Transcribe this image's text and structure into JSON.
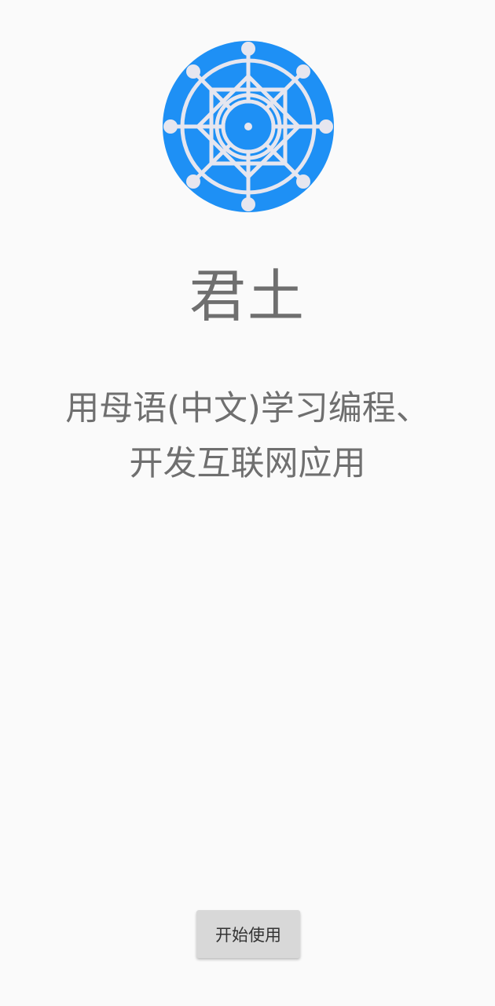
{
  "app": {
    "title": "君土",
    "slogan_line1": "用母语(中文)学习编程、",
    "slogan_line2": "开发互联网应用"
  },
  "actions": {
    "start_label": "开始使用"
  },
  "colors": {
    "background": "#fafafa",
    "logo_blue": "#1e90f5",
    "logo_line": "#e6e6ef",
    "text_gray": "#6f6f6f",
    "button_bg": "#d8d8d8"
  },
  "icons": {
    "logo": "dharma-wheel-logo-icon"
  }
}
